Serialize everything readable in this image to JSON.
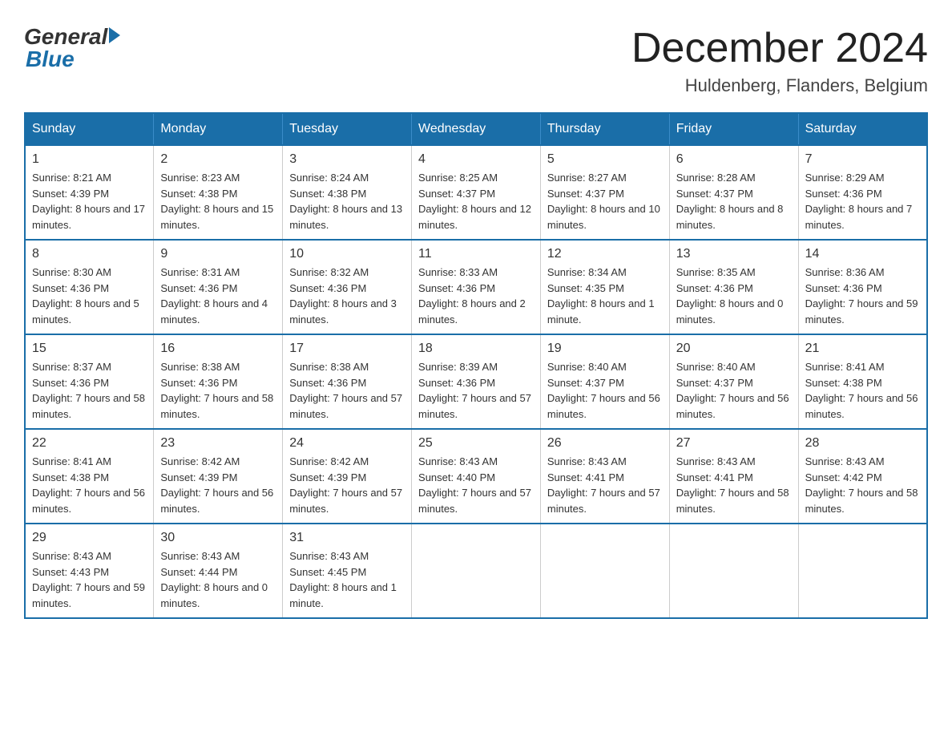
{
  "logo": {
    "general": "General",
    "blue": "Blue"
  },
  "title": "December 2024",
  "subtitle": "Huldenberg, Flanders, Belgium",
  "days_of_week": [
    "Sunday",
    "Monday",
    "Tuesday",
    "Wednesday",
    "Thursday",
    "Friday",
    "Saturday"
  ],
  "weeks": [
    [
      {
        "day": "1",
        "sunrise": "8:21 AM",
        "sunset": "4:39 PM",
        "daylight": "8 hours and 17 minutes."
      },
      {
        "day": "2",
        "sunrise": "8:23 AM",
        "sunset": "4:38 PM",
        "daylight": "8 hours and 15 minutes."
      },
      {
        "day": "3",
        "sunrise": "8:24 AM",
        "sunset": "4:38 PM",
        "daylight": "8 hours and 13 minutes."
      },
      {
        "day": "4",
        "sunrise": "8:25 AM",
        "sunset": "4:37 PM",
        "daylight": "8 hours and 12 minutes."
      },
      {
        "day": "5",
        "sunrise": "8:27 AM",
        "sunset": "4:37 PM",
        "daylight": "8 hours and 10 minutes."
      },
      {
        "day": "6",
        "sunrise": "8:28 AM",
        "sunset": "4:37 PM",
        "daylight": "8 hours and 8 minutes."
      },
      {
        "day": "7",
        "sunrise": "8:29 AM",
        "sunset": "4:36 PM",
        "daylight": "8 hours and 7 minutes."
      }
    ],
    [
      {
        "day": "8",
        "sunrise": "8:30 AM",
        "sunset": "4:36 PM",
        "daylight": "8 hours and 5 minutes."
      },
      {
        "day": "9",
        "sunrise": "8:31 AM",
        "sunset": "4:36 PM",
        "daylight": "8 hours and 4 minutes."
      },
      {
        "day": "10",
        "sunrise": "8:32 AM",
        "sunset": "4:36 PM",
        "daylight": "8 hours and 3 minutes."
      },
      {
        "day": "11",
        "sunrise": "8:33 AM",
        "sunset": "4:36 PM",
        "daylight": "8 hours and 2 minutes."
      },
      {
        "day": "12",
        "sunrise": "8:34 AM",
        "sunset": "4:35 PM",
        "daylight": "8 hours and 1 minute."
      },
      {
        "day": "13",
        "sunrise": "8:35 AM",
        "sunset": "4:36 PM",
        "daylight": "8 hours and 0 minutes."
      },
      {
        "day": "14",
        "sunrise": "8:36 AM",
        "sunset": "4:36 PM",
        "daylight": "7 hours and 59 minutes."
      }
    ],
    [
      {
        "day": "15",
        "sunrise": "8:37 AM",
        "sunset": "4:36 PM",
        "daylight": "7 hours and 58 minutes."
      },
      {
        "day": "16",
        "sunrise": "8:38 AM",
        "sunset": "4:36 PM",
        "daylight": "7 hours and 58 minutes."
      },
      {
        "day": "17",
        "sunrise": "8:38 AM",
        "sunset": "4:36 PM",
        "daylight": "7 hours and 57 minutes."
      },
      {
        "day": "18",
        "sunrise": "8:39 AM",
        "sunset": "4:36 PM",
        "daylight": "7 hours and 57 minutes."
      },
      {
        "day": "19",
        "sunrise": "8:40 AM",
        "sunset": "4:37 PM",
        "daylight": "7 hours and 56 minutes."
      },
      {
        "day": "20",
        "sunrise": "8:40 AM",
        "sunset": "4:37 PM",
        "daylight": "7 hours and 56 minutes."
      },
      {
        "day": "21",
        "sunrise": "8:41 AM",
        "sunset": "4:38 PM",
        "daylight": "7 hours and 56 minutes."
      }
    ],
    [
      {
        "day": "22",
        "sunrise": "8:41 AM",
        "sunset": "4:38 PM",
        "daylight": "7 hours and 56 minutes."
      },
      {
        "day": "23",
        "sunrise": "8:42 AM",
        "sunset": "4:39 PM",
        "daylight": "7 hours and 56 minutes."
      },
      {
        "day": "24",
        "sunrise": "8:42 AM",
        "sunset": "4:39 PM",
        "daylight": "7 hours and 57 minutes."
      },
      {
        "day": "25",
        "sunrise": "8:43 AM",
        "sunset": "4:40 PM",
        "daylight": "7 hours and 57 minutes."
      },
      {
        "day": "26",
        "sunrise": "8:43 AM",
        "sunset": "4:41 PM",
        "daylight": "7 hours and 57 minutes."
      },
      {
        "day": "27",
        "sunrise": "8:43 AM",
        "sunset": "4:41 PM",
        "daylight": "7 hours and 58 minutes."
      },
      {
        "day": "28",
        "sunrise": "8:43 AM",
        "sunset": "4:42 PM",
        "daylight": "7 hours and 58 minutes."
      }
    ],
    [
      {
        "day": "29",
        "sunrise": "8:43 AM",
        "sunset": "4:43 PM",
        "daylight": "7 hours and 59 minutes."
      },
      {
        "day": "30",
        "sunrise": "8:43 AM",
        "sunset": "4:44 PM",
        "daylight": "8 hours and 0 minutes."
      },
      {
        "day": "31",
        "sunrise": "8:43 AM",
        "sunset": "4:45 PM",
        "daylight": "8 hours and 1 minute."
      },
      null,
      null,
      null,
      null
    ]
  ]
}
